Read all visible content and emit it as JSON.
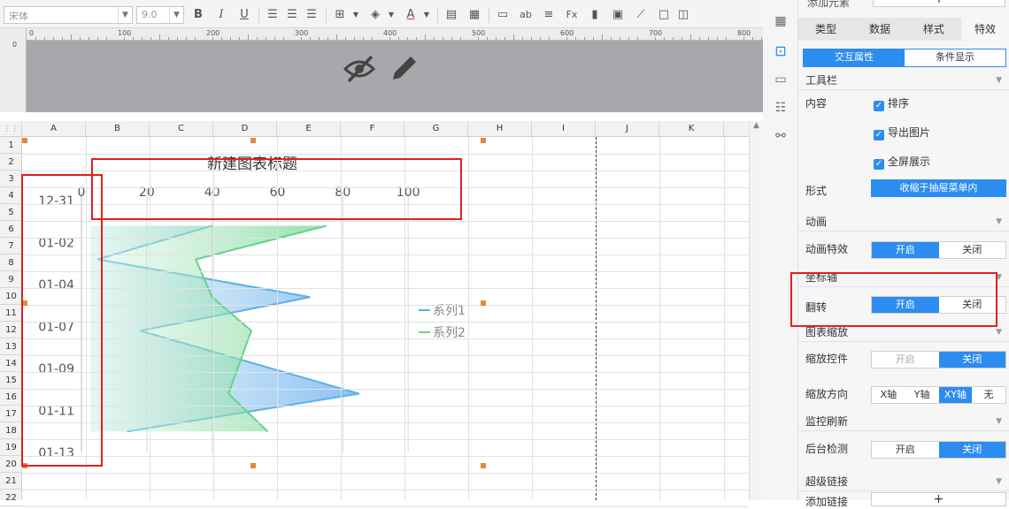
{
  "toolbar": {
    "font_name": "宋体",
    "font_size": "9.0"
  },
  "ruler": {
    "h_ticks": [
      "0",
      "100",
      "200",
      "300",
      "400",
      "500",
      "600",
      "700",
      "800"
    ],
    "v_ticks": [
      "0"
    ]
  },
  "sheet": {
    "columns": [
      "A",
      "B",
      "C",
      "D",
      "E",
      "F",
      "G",
      "H",
      "I",
      "J",
      "K"
    ],
    "rows": [
      "1",
      "2",
      "3",
      "4",
      "5",
      "6",
      "7",
      "8",
      "9",
      "10",
      "11",
      "12",
      "13",
      "14",
      "15",
      "16",
      "17",
      "18",
      "19",
      "20",
      "21",
      "22"
    ]
  },
  "chart_data": {
    "type": "area",
    "title": "新建图表标题",
    "orientation": "horizontal",
    "categories": [
      "12-31",
      "01-02",
      "01-04",
      "01-07",
      "01-09",
      "01-11",
      "01-13"
    ],
    "value_ticks": [
      "0",
      "20",
      "40",
      "60",
      "80",
      "100"
    ],
    "xlim": [
      0,
      120
    ],
    "series": [
      {
        "name": "系列1",
        "color": "#5bb1e6",
        "points": [
          [
            40,
            0.6
          ],
          [
            5,
            1.4
          ],
          [
            70,
            2.3
          ],
          [
            18,
            3.1
          ],
          [
            85,
            4.6
          ],
          [
            14,
            5.5
          ]
        ]
      },
      {
        "name": "系列2",
        "color": "#66d28a",
        "points": [
          [
            75,
            0.6
          ],
          [
            35,
            1.4
          ],
          [
            40,
            2.3
          ],
          [
            52,
            3.1
          ],
          [
            45,
            4.6
          ],
          [
            57,
            5.5
          ]
        ]
      }
    ],
    "grid": true,
    "legend": "right"
  },
  "panel": {
    "top_label": "添加元素",
    "tabs": [
      "类型",
      "数据",
      "样式",
      "特效"
    ],
    "subtabs": [
      "交互属性",
      "条件显示"
    ],
    "toolbar_section": "工具栏",
    "content_label": "内容",
    "checkboxes": [
      "排序",
      "导出图片",
      "全屏展示"
    ],
    "form_label": "形式",
    "form_value": "收缩于抽屉菜单内",
    "anim_section": "动画",
    "anim_effect_label": "动画特效",
    "on": "开启",
    "off": "关闭",
    "axis_section": "坐标轴",
    "flip_label": "翻转",
    "zoom_section": "图表缩放",
    "zoom_ctrl_label": "缩放控件",
    "zoom_dir_label": "缩放方向",
    "zoom_dirs": [
      "X轴",
      "Y轴",
      "XY轴",
      "无"
    ],
    "monitor_section": "监控刷新",
    "bg_check_label": "后台检测",
    "link_section": "超级链接",
    "add_link_label": "添加链接"
  }
}
